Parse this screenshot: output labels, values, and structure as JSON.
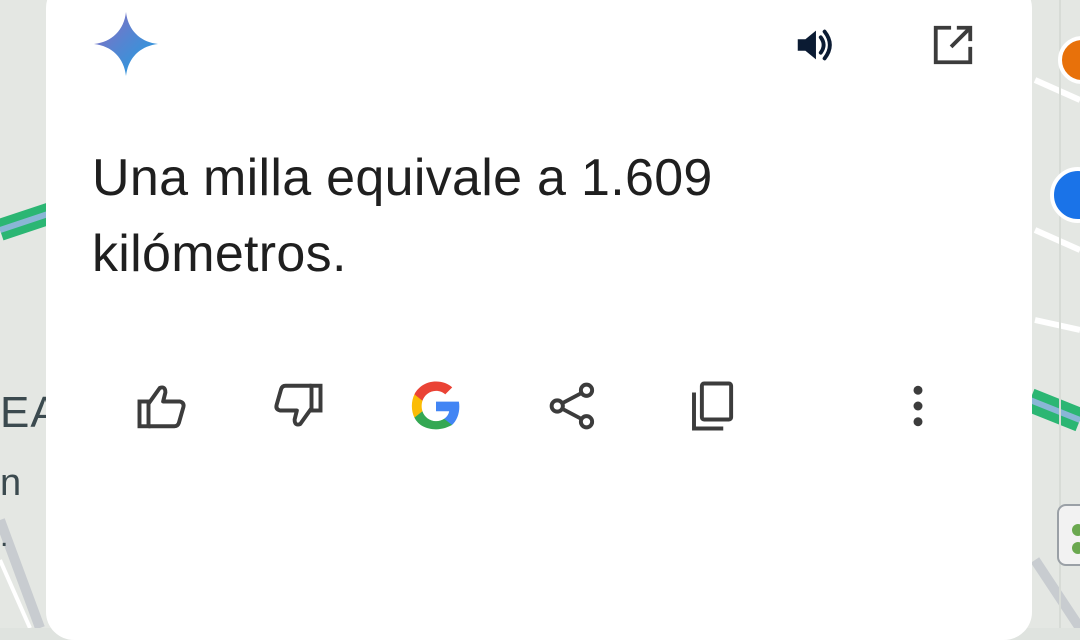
{
  "map": {
    "label_1": "EA",
    "label_2": "n",
    "label_3": "."
  },
  "header": {
    "logo_icon": "gemini-sparkle-icon",
    "speaker_icon": "volume-icon",
    "open_icon": "open-in-new-icon"
  },
  "response": {
    "text": "Una milla equivale a 1.609 kilómetros."
  },
  "actions": [
    {
      "icon": "thumbs-up-icon"
    },
    {
      "icon": "thumbs-down-icon"
    },
    {
      "icon": "google-g-icon"
    },
    {
      "icon": "share-icon"
    },
    {
      "icon": "copy-icon"
    },
    {
      "icon": "more-vert-icon"
    }
  ],
  "colors": {
    "card_bg": "#ffffff",
    "text": "#1f1f1f",
    "icon": "#3c3c3c",
    "map_green": "#2bb673",
    "map_blue": "#1a73e8",
    "map_orange": "#e8710a"
  }
}
